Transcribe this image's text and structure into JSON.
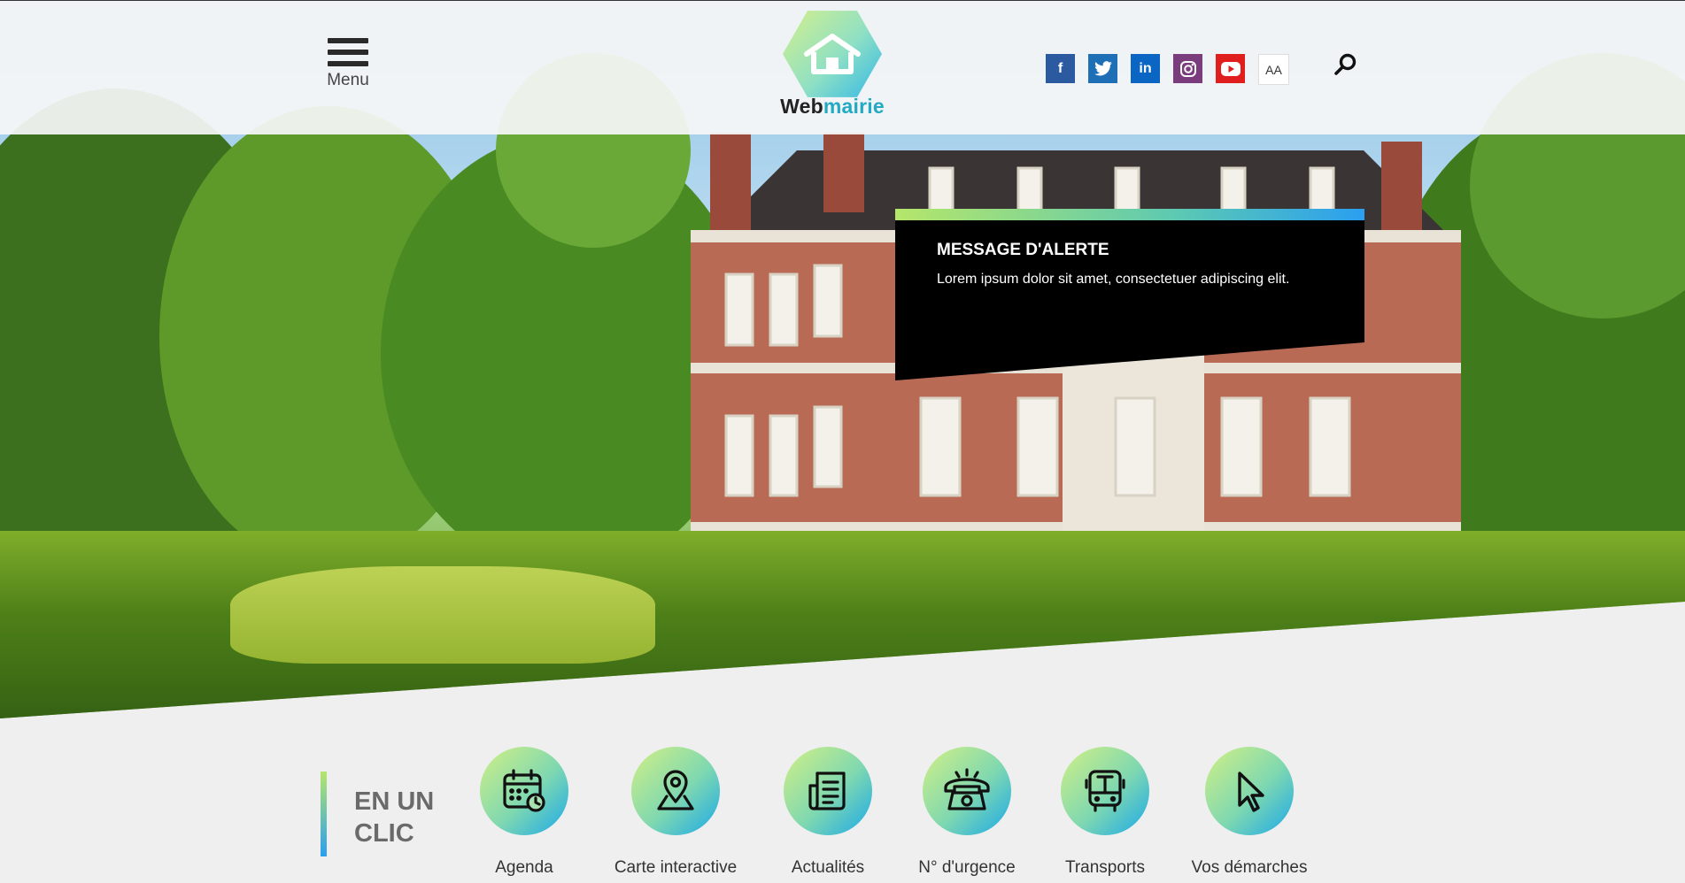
{
  "header": {
    "menu_label": "Menu",
    "logo_text_bold": "Web",
    "logo_text_accent": "mairie",
    "social": [
      {
        "name": "facebook",
        "glyph": "f"
      },
      {
        "name": "twitter",
        "glyph": "t"
      },
      {
        "name": "linkedin",
        "glyph": "in"
      },
      {
        "name": "instagram",
        "glyph": "◎"
      },
      {
        "name": "youtube",
        "glyph": "▶"
      },
      {
        "name": "text-size",
        "glyph": "AA"
      }
    ]
  },
  "alert": {
    "title": "MESSAGE D'ALERTE",
    "text": "Lorem ipsum dolor sit amet, consectetuer adipiscing elit."
  },
  "quick_links": {
    "title": "EN UN CLIC",
    "items": [
      {
        "label": "Agenda",
        "icon": "calendar-icon"
      },
      {
        "label": "Carte interactive",
        "icon": "map-pin-icon"
      },
      {
        "label": "Actualités",
        "icon": "news-icon"
      },
      {
        "label": "N° d'urgence",
        "icon": "phone-icon"
      },
      {
        "label": "Transports",
        "icon": "bus-icon"
      },
      {
        "label": "Vos démarches",
        "icon": "cursor-icon"
      }
    ]
  },
  "colors": {
    "gradient_start": "#d3f085",
    "gradient_end": "#1aa8ea",
    "logo_accent": "#22a9c4",
    "alert_bg": "#000000"
  }
}
